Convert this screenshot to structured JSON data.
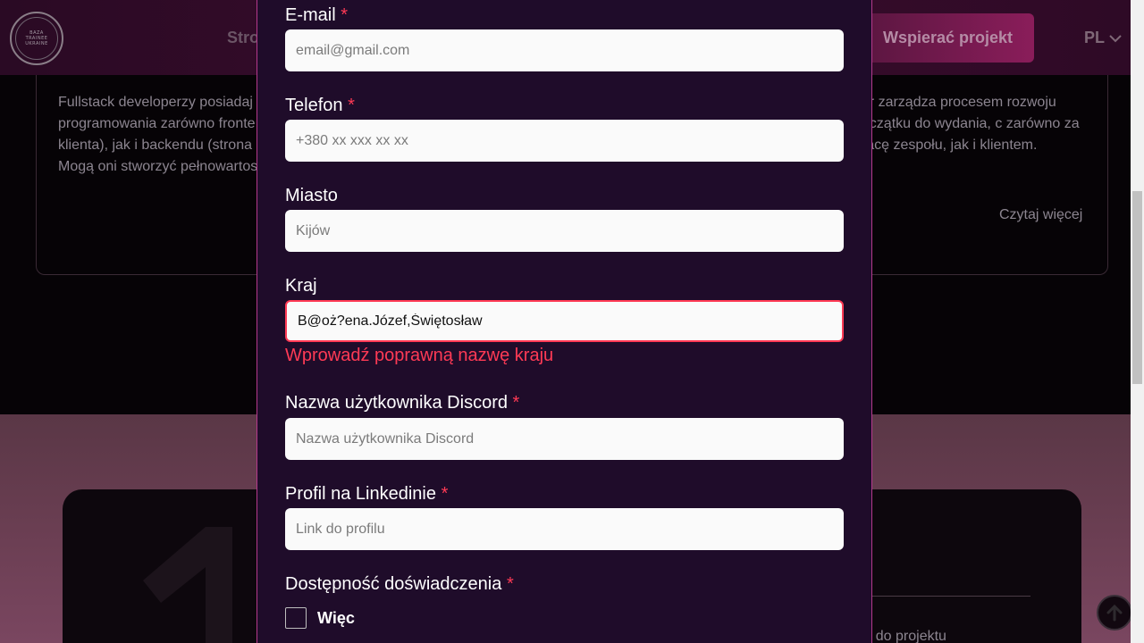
{
  "header": {
    "logo_lines": [
      "BAZA",
      "TRAINEE",
      "UKRAINE"
    ],
    "nav_partial": "Stro",
    "support_button": "Wspierać projekt",
    "language": "PL"
  },
  "background_card": {
    "left_text": "Fullstack developerzy posiadaj programowania zarówno fronte klienta), jak i backendu (strona Mogą oni stworzyć pełnowartos",
    "right_text": "ger zarządza procesem rozwoju początku do wydania, c zarówno za pracę zespołu, jak i klientem.",
    "read_more": "Czytaj więcej"
  },
  "background_lower": {
    "partial_text": "r do projektu"
  },
  "form": {
    "email": {
      "label": "E-mail",
      "required": "*",
      "placeholder": "email@gmail.com",
      "value": ""
    },
    "phone": {
      "label": "Telefon",
      "required": "*",
      "placeholder": "+380 xx xxx xx xx",
      "value": ""
    },
    "city": {
      "label": "Miasto",
      "placeholder": "Kijów",
      "value": ""
    },
    "country": {
      "label": "Kraj",
      "value": "B@oż?ena.Józef,Świętosław",
      "error": "Wprowadź poprawną nazwę kraju"
    },
    "discord": {
      "label": "Nazwa użytkownika Discord",
      "required": "*",
      "placeholder": "Nazwa użytkownika Discord",
      "value": ""
    },
    "linkedin": {
      "label": "Profil na Linkedinie",
      "required": "*",
      "placeholder": "Link do profilu",
      "value": ""
    },
    "experience": {
      "label": "Dostępność doświadczenia",
      "required": "*",
      "option_label": "Więc",
      "checked": false
    }
  },
  "colors": {
    "modal_bg": "#1f0c2a",
    "modal_border": "#b33a8c",
    "error": "#ff3a55",
    "input_bg": "#fafafa"
  }
}
